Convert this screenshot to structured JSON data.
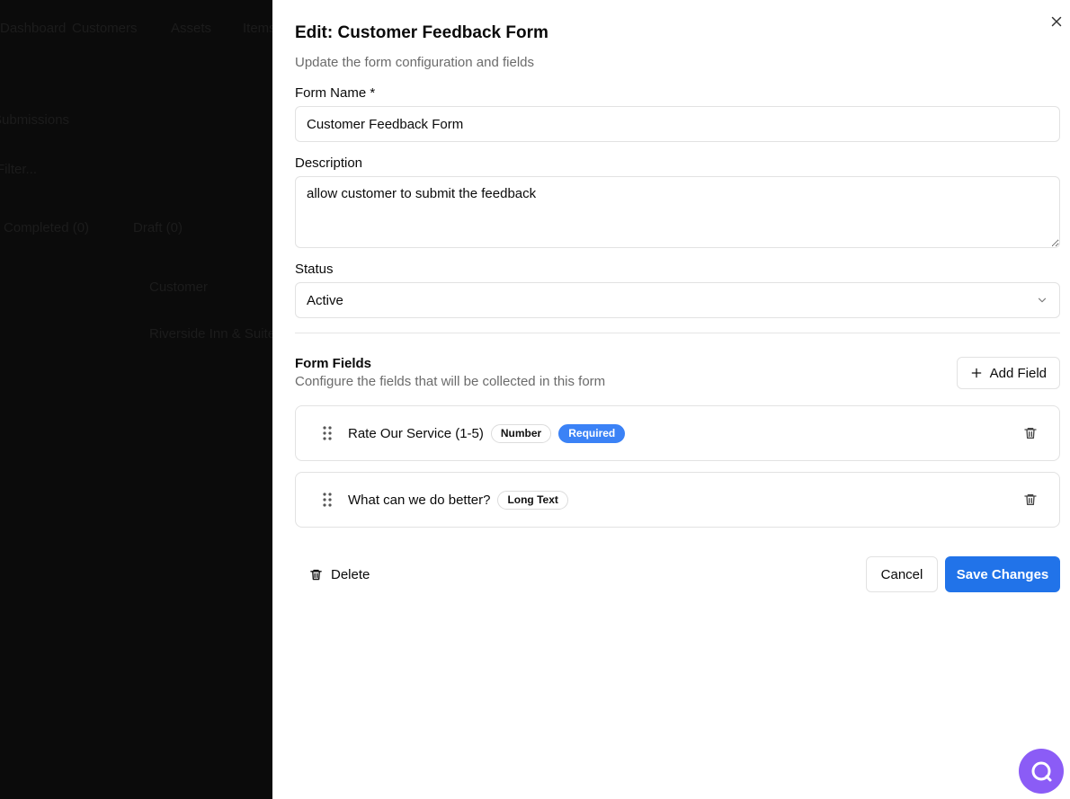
{
  "background": {
    "nav": [
      "Dashboard",
      "Customers",
      "Assets",
      "Items"
    ],
    "text1": "Submissions",
    "text2": "Filter...",
    "tabs": [
      "Completed (0)",
      "Draft (0)"
    ],
    "col_customer": "Customer",
    "row_customer": "Riverside Inn & Suites"
  },
  "drawer": {
    "title": "Edit: Customer Feedback Form",
    "subtitle": "Update the form configuration and fields",
    "form_name_label": "Form Name *",
    "form_name_value": "Customer Feedback Form",
    "description_label": "Description",
    "description_value": "allow customer to submit the feedback",
    "status_label": "Status",
    "status_value": "Active",
    "form_fields_title": "Form Fields",
    "form_fields_subtitle": "Configure the fields that will be collected in this form",
    "add_field_label": "Add Field",
    "fields": [
      {
        "name": "Rate Our Service (1-5)",
        "type": "Number",
        "required_label": "Required"
      },
      {
        "name": "What can we do better?",
        "type": "Long Text"
      }
    ],
    "delete_label": "Delete",
    "cancel_label": "Cancel",
    "save_label": "Save Changes"
  },
  "colors": {
    "primary": "#2173e9",
    "required_badge": "#3b82f6",
    "chat_fab": "#8b5cf6"
  },
  "icons": [
    "close-icon",
    "chevron-down-icon",
    "plus-icon",
    "drag-handle-icon",
    "trash-icon",
    "chat-icon"
  ]
}
